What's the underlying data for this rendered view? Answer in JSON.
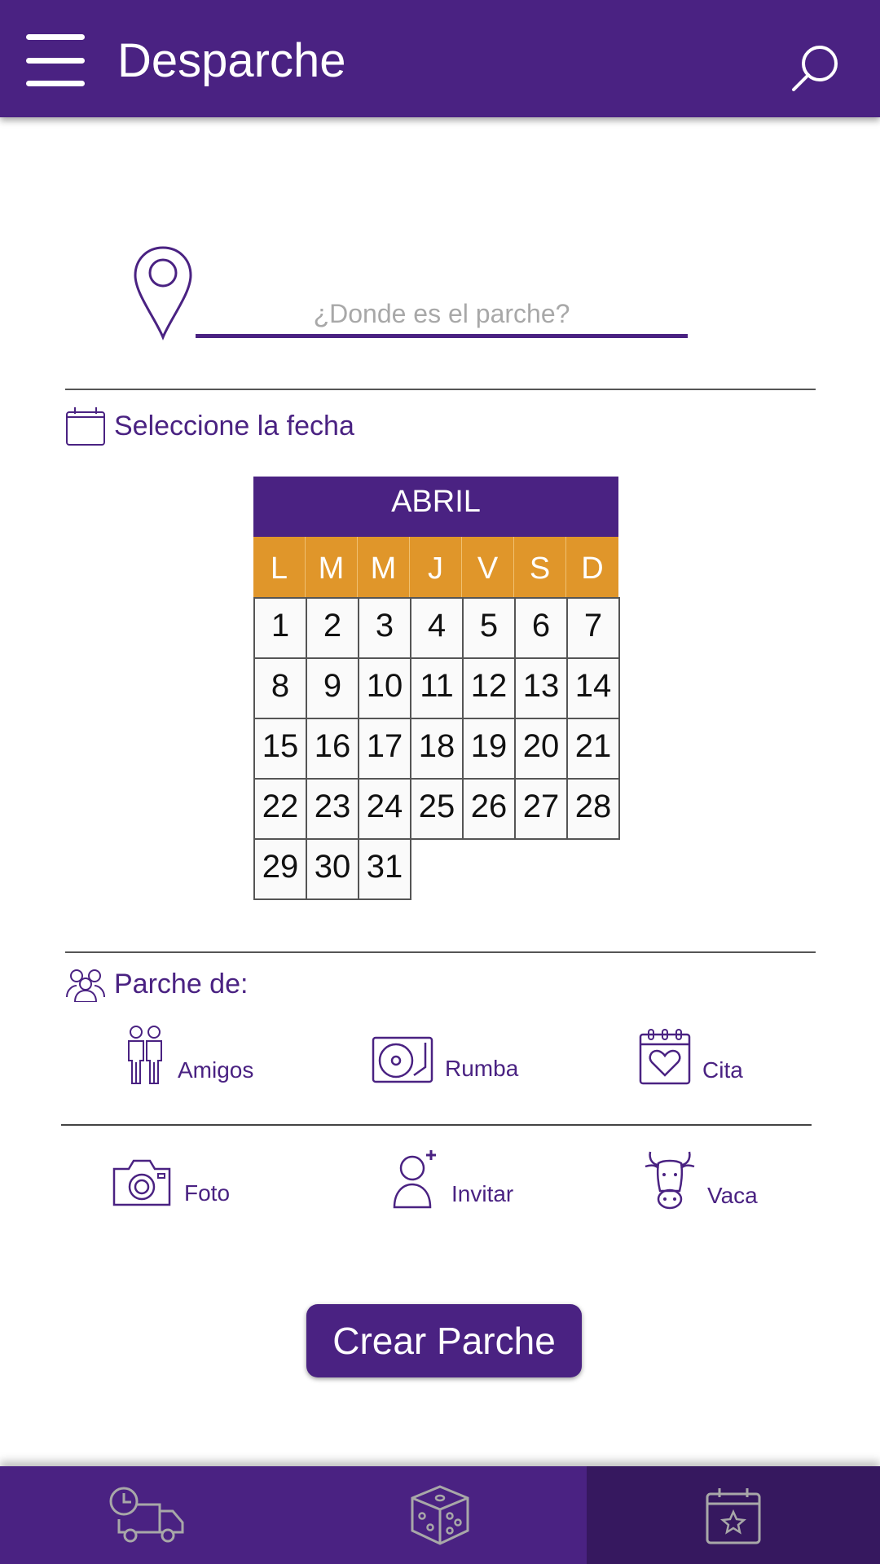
{
  "header": {
    "title": "Desparche",
    "menu_icon": "hamburger-menu-icon",
    "search_icon": "search-icon"
  },
  "location": {
    "placeholder": "¿Donde es el parche?",
    "value": "",
    "icon": "location-pin-icon"
  },
  "date_section": {
    "title": "Seleccione la fecha",
    "icon": "calendar-icon",
    "calendar": {
      "month": "ABRIL",
      "weekdays": [
        "L",
        "M",
        "M",
        "J",
        "V",
        "S",
        "D"
      ],
      "days": [
        "1",
        "2",
        "3",
        "4",
        "5",
        "6",
        "7",
        "8",
        "9",
        "10",
        "11",
        "12",
        "13",
        "14",
        "15",
        "16",
        "17",
        "18",
        "19",
        "20",
        "21",
        "22",
        "23",
        "24",
        "25",
        "26",
        "27",
        "28",
        "29",
        "30",
        "31"
      ]
    }
  },
  "parche_section": {
    "title": "Parche de:",
    "icon": "group-icon",
    "types": [
      {
        "label": "Amigos",
        "icon": "friends-icon"
      },
      {
        "label": "Rumba",
        "icon": "turntable-icon"
      },
      {
        "label": "Cita",
        "icon": "calendar-heart-icon"
      }
    ],
    "extras": [
      {
        "label": "Foto",
        "icon": "camera-icon"
      },
      {
        "label": "Invitar",
        "icon": "invite-user-icon"
      },
      {
        "label": "Vaca",
        "icon": "cow-icon"
      }
    ]
  },
  "create_button": {
    "label": "Crear Parche"
  },
  "bottom_nav": {
    "items": [
      {
        "icon": "delivery-truck-clock-icon"
      },
      {
        "icon": "dice-icon"
      },
      {
        "icon": "calendar-star-icon",
        "active": true
      }
    ]
  },
  "colors": {
    "primary": "#4a2282",
    "accent": "#e0962a",
    "nav_active": "#36185f"
  }
}
